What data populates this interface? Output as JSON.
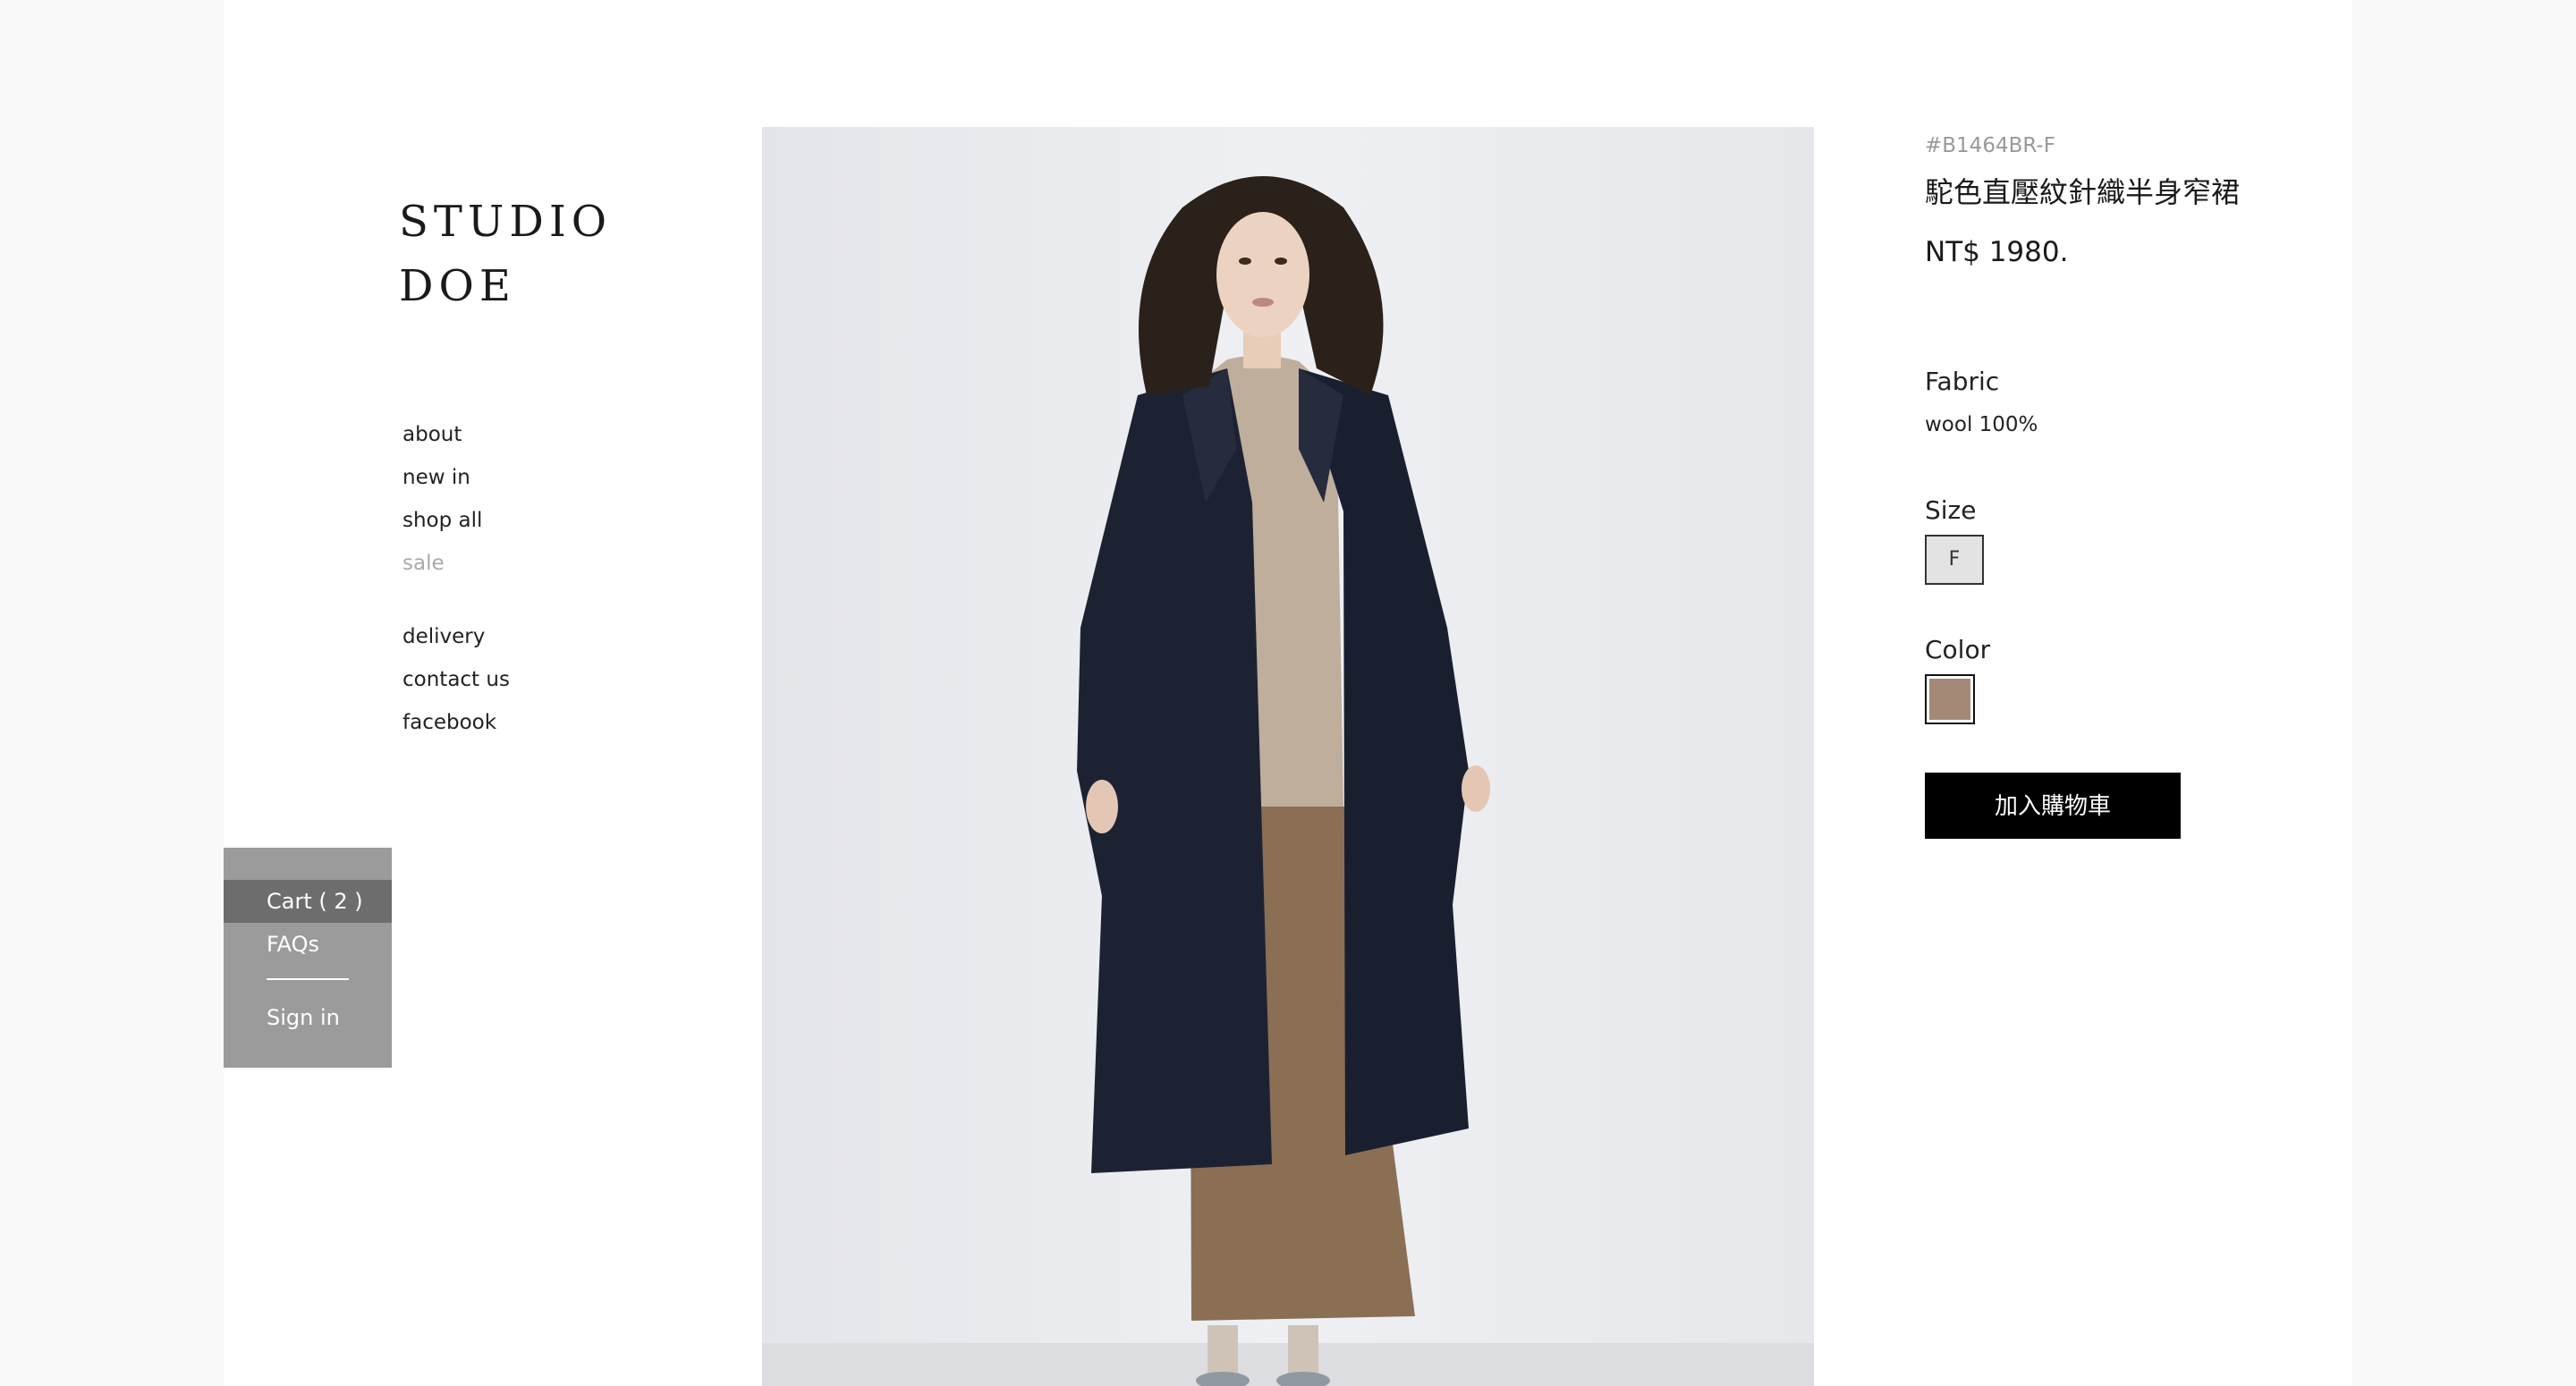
{
  "brand": {
    "line1": "STUDIO",
    "line2": "DOE"
  },
  "nav": {
    "primary": [
      "about",
      "new in",
      "shop all",
      "sale"
    ],
    "secondary": [
      "delivery",
      "contact us",
      "facebook"
    ]
  },
  "cart_menu": {
    "cart": "Cart ( 2 )",
    "faqs": "FAQs",
    "signin": "Sign in"
  },
  "product": {
    "sku": "#B1464BR-F",
    "name": "駝色直壓紋針織半身窄裙",
    "price": "NT$ 1980.",
    "fabric_label": "Fabric",
    "fabric_value": "wool 100%",
    "size_label": "Size",
    "size_options": [
      "F"
    ],
    "color_label": "Color",
    "color_swatch": "#a48a76",
    "add_to_cart": "加入購物車"
  },
  "colors": {
    "accent": "#000000",
    "cart_bg": "#9b9b9b",
    "cart_active": "#6d6d6d",
    "muted_text": "#aaaaaa"
  }
}
